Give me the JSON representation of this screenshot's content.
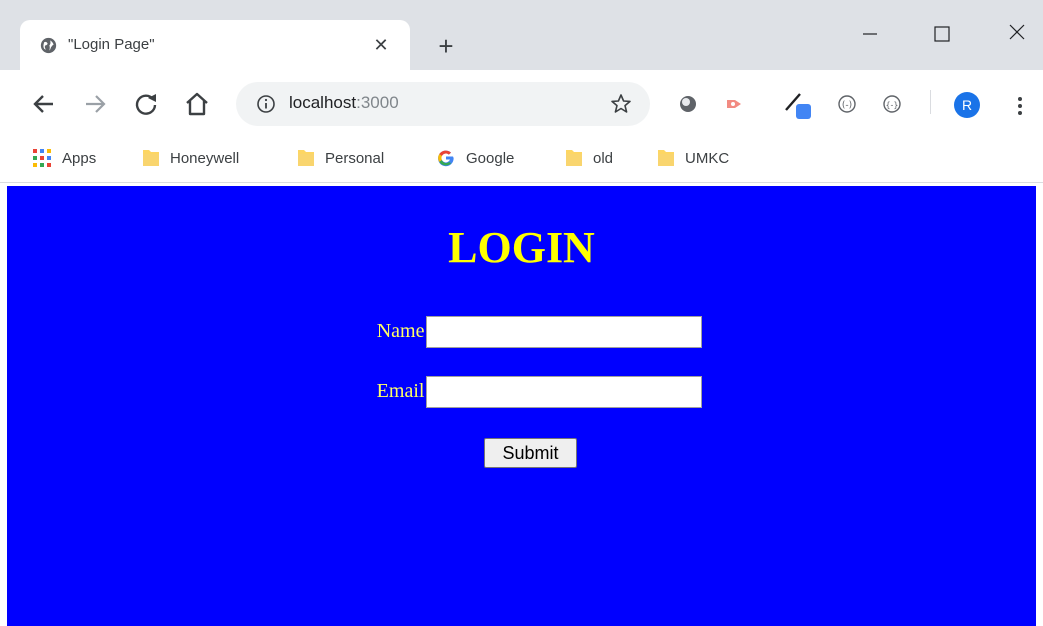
{
  "tab": {
    "title": "\"Login Page\"",
    "close_icon": "close-icon"
  },
  "omnibox": {
    "host": "localhost",
    "port": ":3000"
  },
  "profile": {
    "initial": "R"
  },
  "bookmarks": [
    {
      "label": "Apps",
      "icon": "apps-grid-icon"
    },
    {
      "label": "Honeywell",
      "icon": "folder-icon"
    },
    {
      "label": "Personal",
      "icon": "folder-icon"
    },
    {
      "label": "Google",
      "icon": "google-icon"
    },
    {
      "label": "old",
      "icon": "folder-icon"
    },
    {
      "label": "UMKC",
      "icon": "folder-icon"
    }
  ],
  "login": {
    "title": "LOGIN",
    "name_label": "Name:",
    "name_value": "",
    "email_label": "Email:",
    "email_value": "",
    "submit_label": "Submit"
  },
  "colors": {
    "page_background": "#0000ff",
    "title_color": "#ffff00",
    "label_color": "#ffff66",
    "tabstrip": "#dee1e6",
    "avatar": "#1a73e8"
  }
}
